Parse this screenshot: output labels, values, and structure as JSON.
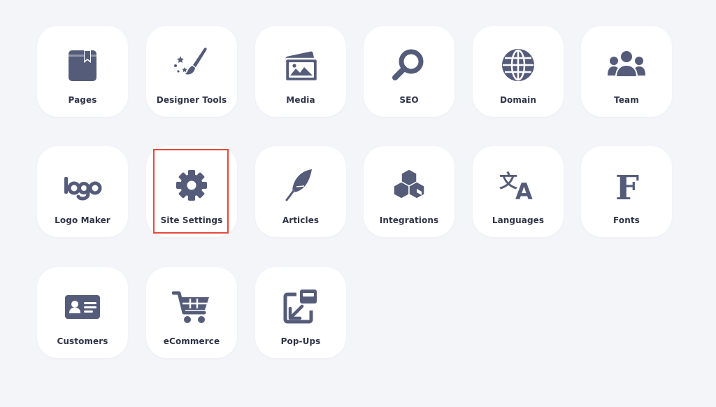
{
  "colors": {
    "background": "#f4f5f9",
    "tile": "#ffffff",
    "icon": "#555c7a",
    "label": "#2f3448",
    "highlight": "#e8473b"
  },
  "tiles": [
    {
      "label": "Pages",
      "icon": "book-icon"
    },
    {
      "label": "Designer Tools",
      "icon": "paintbrush-stars-icon"
    },
    {
      "label": "Media",
      "icon": "images-icon"
    },
    {
      "label": "SEO",
      "icon": "search-icon"
    },
    {
      "label": "Domain",
      "icon": "globe-icon"
    },
    {
      "label": "Team",
      "icon": "team-icon"
    },
    {
      "label": "Logo Maker",
      "icon": "logo-icon"
    },
    {
      "label": "Site Settings",
      "icon": "gear-icon",
      "highlighted": true
    },
    {
      "label": "Articles",
      "icon": "feather-icon"
    },
    {
      "label": "Integrations",
      "icon": "cubes-icon"
    },
    {
      "label": "Languages",
      "icon": "translate-icon"
    },
    {
      "label": "Fonts",
      "icon": "font-icon"
    },
    {
      "label": "Customers",
      "icon": "id-card-icon"
    },
    {
      "label": "eCommerce",
      "icon": "shopping-cart-icon"
    },
    {
      "label": "Pop-Ups",
      "icon": "popup-icon"
    }
  ]
}
